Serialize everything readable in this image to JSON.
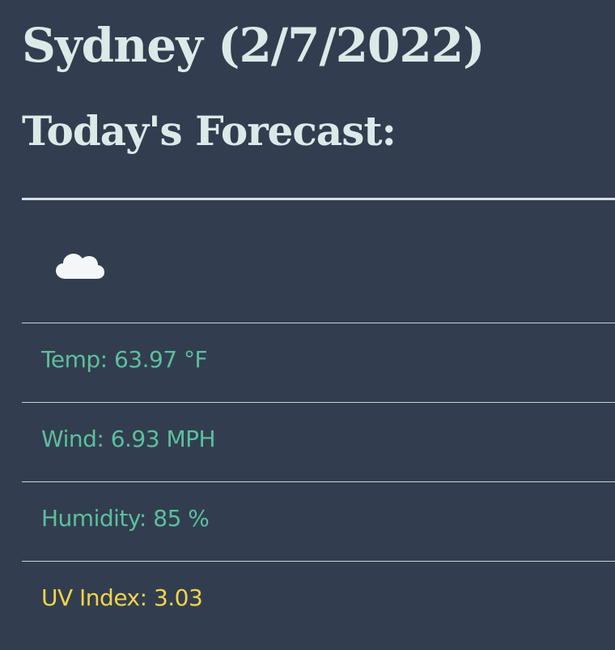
{
  "header": {
    "city_title": "Sydney (2/7/2022)",
    "forecast_title": "Today's Forecast:"
  },
  "weather": {
    "icon": "cloud-icon",
    "temp": "Temp: 63.97 °F",
    "wind": "Wind: 6.93 MPH",
    "humidity": "Humidity: 85 %",
    "uv_index": "UV Index: 3.03"
  },
  "colors": {
    "background": "#323e4f",
    "heading": "#dde9e8",
    "detail_text": "#5cbf9e",
    "uv_text": "#f0d34e",
    "divider": "#c9d2d8"
  }
}
